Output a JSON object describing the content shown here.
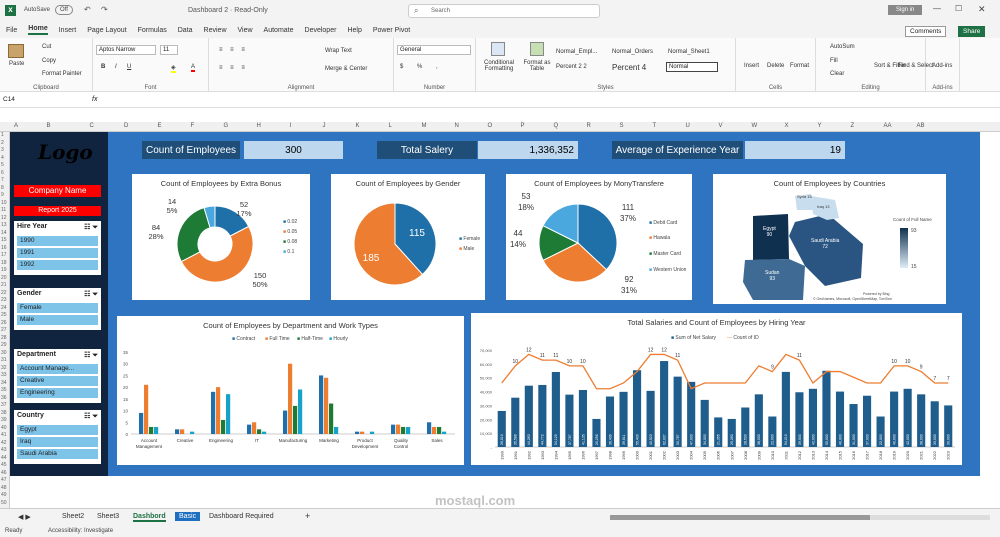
{
  "titlebar": {
    "autosave": "AutoSave",
    "autosave_state": "Off",
    "doc_title": "Dashboard 2 · Read-Only",
    "search_placeholder": "Search",
    "signin": "Sign in"
  },
  "tabs": [
    "File",
    "Home",
    "Insert",
    "Page Layout",
    "Formulas",
    "Data",
    "Review",
    "View",
    "Automate",
    "Developer",
    "Help",
    "Power Pivot"
  ],
  "ribbon": {
    "comments": "Comments",
    "share": "Share",
    "paste": "Paste",
    "cut": "Cut",
    "copy": "Copy",
    "format_painter": "Format Painter",
    "clipboard": "Clipboard",
    "font_name": "Aptos Narrow",
    "font_size": "11",
    "font": "Font",
    "wrap_text": "Wrap Text",
    "merge_center": "Merge & Center",
    "alignment": "Alignment",
    "number_format": "General",
    "number": "Number",
    "cond_format": "Conditional Formatting",
    "format_table": "Format as Table",
    "style1": "Normal_Empl...",
    "style2": "Normal_Orders",
    "style3": "Normal_Sheet1",
    "style4": "Percent 2 2",
    "style5": "Percent 4",
    "style6": "Normal",
    "styles": "Styles",
    "insert": "Insert",
    "delete": "Delete",
    "format": "Format",
    "cells": "Cells",
    "autosum": "AutoSum",
    "fill": "Fill",
    "clear": "Clear",
    "sort_filter": "Sort & Filter",
    "find_select": "Find & Select",
    "editing": "Editing",
    "addins": "Add-ins"
  },
  "formula_bar": {
    "cell_ref": "C14",
    "fx": "fx",
    "content": ""
  },
  "columns": [
    "A",
    "B",
    "C",
    "D",
    "E",
    "F",
    "G",
    "H",
    "I",
    "J",
    "K",
    "L",
    "M",
    "N",
    "O",
    "P",
    "Q",
    "R",
    "S",
    "T",
    "U",
    "V",
    "W",
    "X",
    "Y",
    "Z",
    "AA",
    "AB"
  ],
  "rows": [
    "1",
    "2",
    "3",
    "4",
    "5",
    "6",
    "7",
    "8",
    "9",
    "10",
    "11",
    "12",
    "13",
    "14",
    "15",
    "16",
    "17",
    "18",
    "19",
    "20",
    "21",
    "22",
    "23",
    "24",
    "25",
    "26",
    "27",
    "28",
    "29",
    "30",
    "31",
    "32",
    "33",
    "34",
    "35",
    "36",
    "37",
    "38",
    "39",
    "40",
    "41",
    "42",
    "43",
    "44",
    "45",
    "46",
    "47",
    "48",
    "49",
    "50"
  ],
  "sidebar": {
    "logo": "Logo",
    "company": "Company Name",
    "report": "Report 2025"
  },
  "slicers": [
    {
      "title": "Hire Year",
      "items": [
        "1990",
        "1991",
        "1992"
      ]
    },
    {
      "title": "Gender",
      "items": [
        "Female",
        "Male"
      ]
    },
    {
      "title": "Department",
      "items": [
        "Account Manage...",
        "Creative",
        "Engineering"
      ]
    },
    {
      "title": "Country",
      "items": [
        "Egypt",
        "Iraq",
        "Saudi Arabia"
      ]
    }
  ],
  "kpis": [
    {
      "label": "Count of Employees",
      "value": "300"
    },
    {
      "label": "Total Salery",
      "value": "1,336,352"
    },
    {
      "label": "Average of Experience Year",
      "value": "19"
    }
  ],
  "charts": {
    "bonus": {
      "title": "Count of Employees by Extra Bonus",
      "legend": [
        "0.02",
        "0.05",
        "0.08",
        "0.1"
      ]
    },
    "gender": {
      "title": "Count of Employees by Gender",
      "legend": [
        "Female",
        "Male"
      ]
    },
    "money": {
      "title": "Count of Employees by MonyTransfere",
      "legend": [
        "Debit Card",
        "Hawala",
        "Master Card",
        "Western Union"
      ]
    },
    "countries": {
      "title": "Count of Employees by Countries",
      "legend_title": "Count of Full Name",
      "legend_max": "93",
      "legend_min": "15",
      "map_labels": [
        "Egypt",
        "Iraq",
        "Syria",
        "Saudi Arabia",
        "Sudan"
      ],
      "map_values": [
        "90",
        "13",
        "15",
        "72",
        "93"
      ],
      "credit1": "Powered by Bing",
      "credit2": "© GeoNames, Microsoft, OpenStreetMap, TomTom"
    },
    "dept": {
      "title": "Count of Employees by Department and Work Types",
      "legend": [
        "Contract",
        "Full Time",
        "Half-Time",
        "Hourly"
      ],
      "yticks": [
        "0",
        "5",
        "10",
        "15",
        "20",
        "25",
        "30",
        "35"
      ]
    },
    "hiring": {
      "title": "Total Salaries and Count of Employees by Hiring Year",
      "legend": [
        "Sum of Net Salary",
        "Count of ID"
      ],
      "yticks": [
        "-",
        "10,000",
        "20,000",
        "30,000",
        "40,000",
        "50,000",
        "60,000",
        "70,000"
      ]
    }
  },
  "chart_data": [
    {
      "type": "pie",
      "name": "Count of Employees by Extra Bonus",
      "donut": true,
      "labels": [
        "0.02",
        "0.05",
        "0.08",
        "0.1"
      ],
      "values": [
        52,
        150,
        84,
        14
      ],
      "percents": [
        "17%",
        "50%",
        "28%",
        "5%"
      ]
    },
    {
      "type": "pie",
      "name": "Count of Employees by Gender",
      "labels": [
        "Female",
        "Male"
      ],
      "values": [
        115,
        185
      ]
    },
    {
      "type": "pie",
      "name": "Count of Employees by MonyTransfere",
      "labels": [
        "Debit Card",
        "Hawala",
        "Master Card",
        "Western Union"
      ],
      "values": [
        111,
        92,
        44,
        53
      ],
      "percents": [
        "37%",
        "31%",
        "14%",
        "18%"
      ]
    },
    {
      "type": "bar",
      "name": "Count of Employees by Department and Work Types",
      "categories": [
        "Account Management",
        "Creative",
        "Engineering",
        "IT",
        "Manufacturing",
        "Marketing",
        "Product Development",
        "Quality Control",
        "Sales"
      ],
      "series": [
        {
          "name": "Contract",
          "values": [
            9,
            2,
            18,
            4,
            10,
            25,
            1,
            4,
            5
          ]
        },
        {
          "name": "Full Time",
          "values": [
            21,
            2,
            20,
            5,
            30,
            24,
            1,
            4,
            3
          ]
        },
        {
          "name": "Half-Time",
          "values": [
            3,
            0,
            6,
            2,
            12,
            13,
            0,
            3,
            3
          ]
        },
        {
          "name": "Hourly",
          "values": [
            3,
            1,
            17,
            1,
            19,
            3,
            1,
            3,
            1
          ]
        }
      ],
      "ylim": [
        0,
        35
      ]
    },
    {
      "type": "bar+line",
      "name": "Total Salaries and Count of Employees by Hiring Year",
      "categories": [
        "1990",
        "1991",
        "1992",
        "1993",
        "1994",
        "1995",
        "1996",
        "1997",
        "1998",
        "1999",
        "2000",
        "2001",
        "2002",
        "2003",
        "2004",
        "2005",
        "2006",
        "2007",
        "2008",
        "2009",
        "2010",
        "2011",
        "2012",
        "2013",
        "2014",
        "2015",
        "2016",
        "2017",
        "2018",
        "2019",
        "2020",
        "2021",
        "2022",
        "2023"
      ],
      "series": [
        {
          "name": "Sum of Net Salary",
          "values": [
            26010,
            35588,
            44263,
            44772,
            54120,
            37787,
            41135,
            20256,
            36436,
            39811,
            55409,
            40523,
            62037,
            50787,
            47000,
            34000,
            21355,
            20260,
            28500,
            38000,
            22000,
            54210,
            39500,
            42000,
            55000,
            40000,
            31000,
            37000,
            22000,
            40000,
            42000,
            38000,
            33000,
            30000
          ]
        },
        {
          "name": "Count of ID",
          "values": [
            7,
            10,
            12,
            11,
            11,
            10,
            10,
            6,
            6,
            7,
            9,
            12,
            12,
            11,
            6,
            7,
            7,
            7,
            7,
            10,
            9,
            12,
            11,
            7,
            9,
            9,
            8,
            7,
            7,
            10,
            10,
            9,
            7,
            7
          ]
        }
      ],
      "ylim": [
        0,
        70000
      ]
    }
  ],
  "sheet_tabs": [
    "Sheet2",
    "Sheet3",
    "Dashbord",
    "Basic",
    "Dashboard Required"
  ],
  "status": {
    "ready": "Ready",
    "accessibility": "Accessibility: Investigate"
  },
  "watermark": "mostaql.com"
}
